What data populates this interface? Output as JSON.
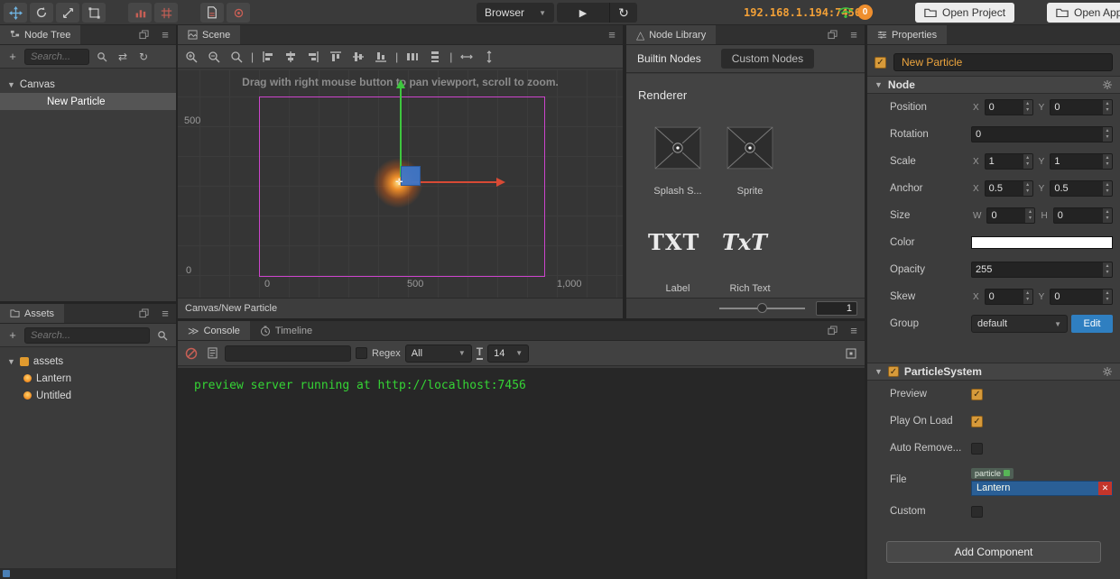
{
  "toolbar": {
    "browser_label": "Browser",
    "ip": "192.168.1.194:7456",
    "badge_count": "0",
    "open_project_label": "Open Project",
    "open_app_label": "Open App"
  },
  "node_tree": {
    "title": "Node Tree",
    "search_placeholder": "Search...",
    "root_label": "Canvas",
    "child_label": "New Particle"
  },
  "assets": {
    "title": "Assets",
    "search_placeholder": "Search...",
    "root_label": "assets",
    "items": [
      {
        "label": "Lantern"
      },
      {
        "label": "Untitled"
      }
    ]
  },
  "scene": {
    "tab_label": "Scene",
    "hint": "Drag with right mouse button to pan viewport, scroll to zoom.",
    "ruler_left_top": "500",
    "ruler_left_bottom": "0",
    "ruler_bottom": [
      "0",
      "500",
      "1,000"
    ],
    "footer_breadcrumb": "Canvas/New Particle"
  },
  "node_library": {
    "title": "Node Library",
    "tab_builtin": "Builtin Nodes",
    "tab_custom": "Custom Nodes",
    "section_title": "Renderer",
    "items": [
      {
        "label": "Splash S..."
      },
      {
        "label": "Sprite"
      },
      {
        "label": "Label",
        "glyph": "TXT"
      },
      {
        "label": "Rich Text",
        "glyph": "TxT"
      }
    ],
    "zoom_value": "1"
  },
  "console": {
    "tab_label": "Console",
    "timeline_label": "Timeline",
    "regex_label": "Regex",
    "filter_value": "All",
    "font_size_value": "14",
    "log_line": "preview server running at http://localhost:7456"
  },
  "properties": {
    "title": "Properties",
    "node_name": "New Particle",
    "node_section": "Node",
    "rows": [
      {
        "label": "Position",
        "x_label": "X",
        "x": "0",
        "y_label": "Y",
        "y": "0"
      },
      {
        "label": "Rotation",
        "value": "0"
      },
      {
        "label": "Scale",
        "x_label": "X",
        "x": "1",
        "y_label": "Y",
        "y": "1"
      },
      {
        "label": "Anchor",
        "x_label": "X",
        "x": "0.5",
        "y_label": "Y",
        "y": "0.5"
      },
      {
        "label": "Size",
        "x_label": "W",
        "x": "0",
        "y_label": "H",
        "y": "0"
      },
      {
        "label": "Color",
        "value": "#ffffff"
      },
      {
        "label": "Opacity",
        "value": "255"
      },
      {
        "label": "Skew",
        "x_label": "X",
        "x": "0",
        "y_label": "Y",
        "y": "0"
      },
      {
        "label": "Group",
        "value": "default",
        "edit_label": "Edit"
      }
    ],
    "particle_section": "ParticleSystem",
    "particle_rows": [
      {
        "label": "Preview",
        "checked": true
      },
      {
        "label": "Play On Load",
        "checked": true
      },
      {
        "label": "Auto Remove...",
        "checked": false
      }
    ],
    "file_label": "File",
    "file_type_badge": "particle",
    "file_value": "Lantern",
    "custom_label": "Custom",
    "add_component_label": "Add Component"
  },
  "colors": {
    "accent_orange": "#eda53e",
    "console_green": "#35d435",
    "canvas_outline": "#cc44cc",
    "wifi_green": "#3fbf3f",
    "edit_blue": "#2f7fc1"
  }
}
